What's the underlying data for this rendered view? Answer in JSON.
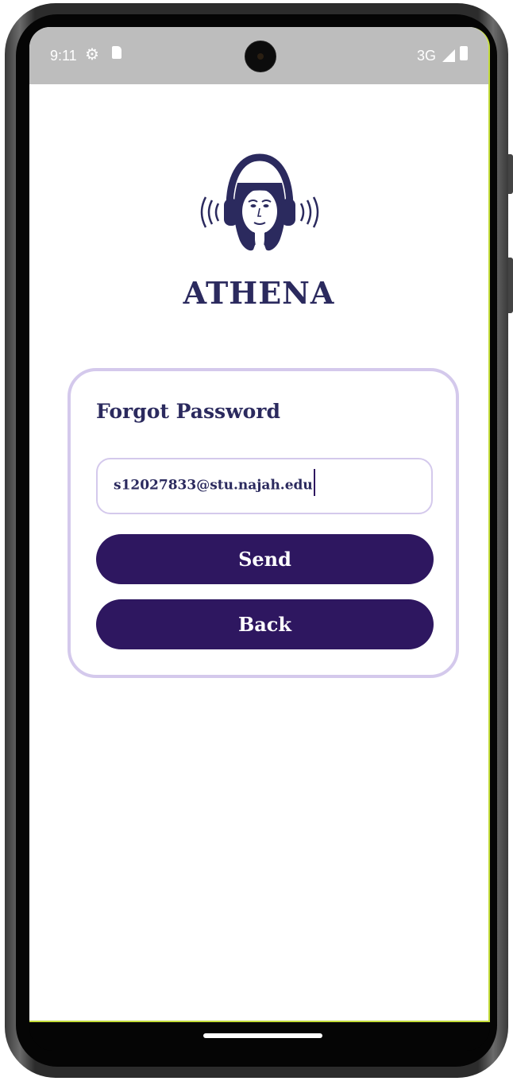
{
  "status_bar": {
    "time": "9:11",
    "network": "3G",
    "icons": [
      "gear-icon",
      "sd-card-icon",
      "signal-icon",
      "battery-icon"
    ]
  },
  "app": {
    "name": "ATHENA",
    "logo_icon": "woman-headphones-logo"
  },
  "forgot_password": {
    "title": "Forgot Password",
    "email_value": "s12027833@stu.najah.edu",
    "send_label": "Send",
    "back_label": "Back"
  },
  "colors": {
    "primary": "#2e1760",
    "title_text": "#2b2a5e",
    "card_border": "#d4c9ec",
    "status_bar_bg": "#bdbdbd",
    "screen_bg": "#ffffff"
  }
}
